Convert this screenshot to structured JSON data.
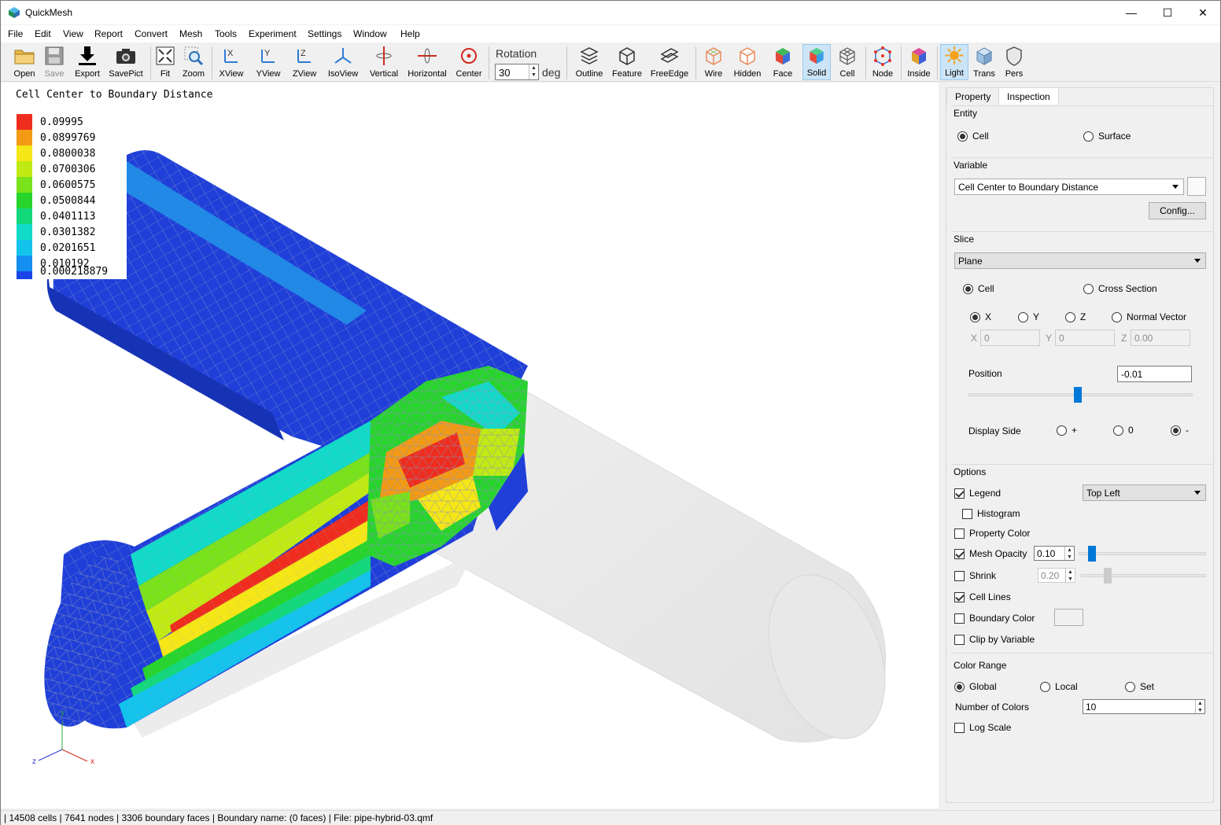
{
  "window": {
    "title": "QuickMesh",
    "controls": {
      "minimize": "—",
      "maximize": "☐",
      "close": "✕"
    }
  },
  "menu": [
    "File",
    "Edit",
    "View",
    "Report",
    "Convert",
    "Mesh",
    "Tools",
    "Experiment",
    "Settings",
    "Window",
    "Help"
  ],
  "toolbar": {
    "buttons": [
      {
        "label": "Open",
        "icon": "folder-icon"
      },
      {
        "label": "Save",
        "icon": "floppy-icon",
        "disabled": true
      },
      {
        "label": "Export",
        "icon": "download-icon"
      },
      {
        "label": "SavePict",
        "icon": "camera-icon"
      },
      {
        "label": "Fit",
        "icon": "fit-icon"
      },
      {
        "label": "Zoom",
        "icon": "zoom-icon"
      },
      {
        "label": "XView",
        "icon": "xview-icon"
      },
      {
        "label": "YView",
        "icon": "yview-icon"
      },
      {
        "label": "ZView",
        "icon": "zview-icon"
      },
      {
        "label": "IsoView",
        "icon": "isoview-icon"
      },
      {
        "label": "Vertical",
        "icon": "vertical-rotate-icon"
      },
      {
        "label": "Horizontal",
        "icon": "horizontal-rotate-icon"
      },
      {
        "label": "Center",
        "icon": "center-icon"
      },
      {
        "label": "Outline",
        "icon": "outline-icon"
      },
      {
        "label": "Feature",
        "icon": "feature-icon"
      },
      {
        "label": "FreeEdge",
        "icon": "freeedge-icon"
      },
      {
        "label": "Wire",
        "icon": "wire-icon"
      },
      {
        "label": "Hidden",
        "icon": "hidden-icon"
      },
      {
        "label": "Face",
        "icon": "face-icon"
      },
      {
        "label": "Solid",
        "icon": "solid-icon",
        "active": true
      },
      {
        "label": "Cell",
        "icon": "cell-icon"
      },
      {
        "label": "Node",
        "icon": "node-icon"
      },
      {
        "label": "Inside",
        "icon": "inside-icon"
      },
      {
        "label": "Light",
        "icon": "light-icon",
        "active": true
      },
      {
        "label": "Trans",
        "icon": "trans-icon"
      },
      {
        "label": "Pers",
        "icon": "pers-icon"
      }
    ],
    "rotation": {
      "label": "Rotation",
      "value": "30",
      "unit": "deg"
    }
  },
  "viewport": {
    "title": "Cell Center to Boundary Distance",
    "legend": [
      {
        "value": "0.09995",
        "color": "#ee2d1e"
      },
      {
        "value": "0.0899769",
        "color": "#f39a14"
      },
      {
        "value": "0.0800038",
        "color": "#f5e617"
      },
      {
        "value": "0.0700306",
        "color": "#c0ea14"
      },
      {
        "value": "0.0600575",
        "color": "#79e21a"
      },
      {
        "value": "0.0500844",
        "color": "#27d42c"
      },
      {
        "value": "0.0401113",
        "color": "#13d77b"
      },
      {
        "value": "0.0301382",
        "color": "#12dbc8"
      },
      {
        "value": "0.0201651",
        "color": "#13c3ec"
      },
      {
        "value": "0.010192",
        "color": "#148ef0"
      },
      {
        "value": "0.000218879",
        "color": "#1a45e6"
      }
    ],
    "axes": {
      "x": "x",
      "y": "y",
      "z": "z"
    }
  },
  "panel": {
    "tabs": [
      "Property",
      "Inspection"
    ],
    "entity": {
      "title": "Entity",
      "options": [
        "Cell",
        "Surface"
      ],
      "selected": "Cell"
    },
    "variable": {
      "title": "Variable",
      "value": "Cell Center to Boundary Distance",
      "config_label": "Config..."
    },
    "slice": {
      "title": "Slice",
      "type": "Plane",
      "mode_options": [
        "Cell",
        "Cross Section"
      ],
      "mode_selected": "Cell",
      "axis_options": [
        "X",
        "Y",
        "Z",
        "Normal Vector"
      ],
      "axis_selected": "X",
      "vec_labels": [
        "X",
        "Y",
        "Z"
      ],
      "vec_values": [
        "0",
        "0",
        "0.00"
      ],
      "position_label": "Position",
      "position_value": "-0.01",
      "position_slider_fraction": 0.5,
      "display_side_label": "Display Side",
      "display_side_options": [
        "+",
        "0",
        "-"
      ],
      "display_side_selected": "-"
    },
    "options": {
      "title": "Options",
      "legend_label": "Legend",
      "legend_checked": true,
      "legend_position": "Top Left",
      "histogram_label": "Histogram",
      "property_color_label": "Property Color",
      "mesh_opacity_label": "Mesh Opacity",
      "mesh_opacity_value": "0.10",
      "mesh_opacity_fraction": 0.1,
      "shrink_label": "Shrink",
      "shrink_value": "0.20",
      "shrink_fraction": 0.2,
      "cell_lines_label": "Cell Lines",
      "boundary_color_label": "Boundary Color",
      "clip_label": "Clip by Variable"
    },
    "color_range": {
      "title": "Color Range",
      "options": [
        "Global",
        "Local",
        "Set"
      ],
      "selected": "Global",
      "num_colors_label": "Number of Colors",
      "num_colors_value": "10",
      "log_scale_label": "Log Scale"
    }
  },
  "status": "| 14508 cells | 7641 nodes | 3306 boundary faces |  Boundary name:  (0 faces) | File: pipe-hybrid-03.qmf"
}
